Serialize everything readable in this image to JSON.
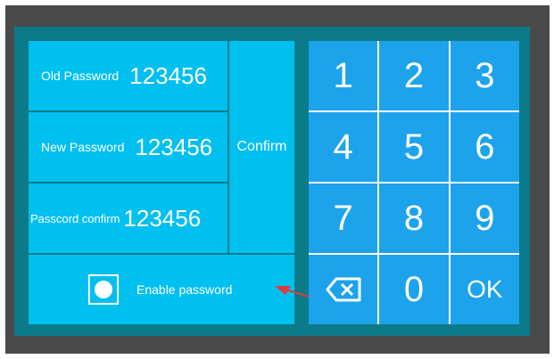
{
  "fields": [
    {
      "label": "Old Password",
      "value": "123456"
    },
    {
      "label": "New Password",
      "value": "123456"
    },
    {
      "label": "Passcord confirm",
      "value": "123456"
    }
  ],
  "confirm_label": "Confirm",
  "enable_label": "Enable password",
  "keypad": [
    "1",
    "2",
    "3",
    "4",
    "5",
    "6",
    "7",
    "8",
    "9",
    "0",
    "OK"
  ],
  "backspace_icon": "backspace-icon",
  "colors": {
    "frame": "#4a4a4a",
    "panel": "#0b7b8a",
    "field_bg": "#00c0f0",
    "key_bg": "#1ca3ec",
    "arrow": "#e03a3a"
  }
}
